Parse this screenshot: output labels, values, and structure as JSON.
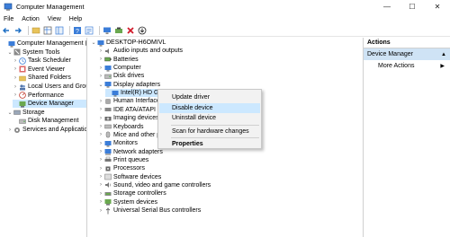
{
  "window": {
    "title": "Computer Management",
    "controls": {
      "minimize": "—",
      "maximize": "☐",
      "close": "✕"
    }
  },
  "menu": [
    "File",
    "Action",
    "View",
    "Help"
  ],
  "left_tree": [
    {
      "label": "Computer Management (Local",
      "indent": 0,
      "expander": "",
      "selected": false
    },
    {
      "label": "System Tools",
      "indent": 1,
      "expander": "⌄",
      "selected": false
    },
    {
      "label": "Task Scheduler",
      "indent": 2,
      "expander": "›",
      "selected": false
    },
    {
      "label": "Event Viewer",
      "indent": 2,
      "expander": "›",
      "selected": false
    },
    {
      "label": "Shared Folders",
      "indent": 2,
      "expander": "›",
      "selected": false
    },
    {
      "label": "Local Users and Groups",
      "indent": 2,
      "expander": "›",
      "selected": false
    },
    {
      "label": "Performance",
      "indent": 2,
      "expander": "›",
      "selected": false
    },
    {
      "label": "Device Manager",
      "indent": 2,
      "expander": "",
      "selected": true
    },
    {
      "label": "Storage",
      "indent": 1,
      "expander": "⌄",
      "selected": false
    },
    {
      "label": "Disk Management",
      "indent": 2,
      "expander": "",
      "selected": false
    },
    {
      "label": "Services and Applications",
      "indent": 1,
      "expander": "›",
      "selected": false
    }
  ],
  "device_tree": [
    {
      "label": "DESKTOP-H6OMIVL",
      "indent": 0,
      "expander": "⌄"
    },
    {
      "label": "Audio inputs and outputs",
      "indent": 1,
      "expander": "›"
    },
    {
      "label": "Batteries",
      "indent": 1,
      "expander": "›"
    },
    {
      "label": "Computer",
      "indent": 1,
      "expander": "›"
    },
    {
      "label": "Disk drives",
      "indent": 1,
      "expander": "›"
    },
    {
      "label": "Display adapters",
      "indent": 1,
      "expander": "⌄"
    },
    {
      "label": "Intel(R) HD G",
      "indent": 2,
      "expander": "",
      "selected": true
    },
    {
      "label": "Human Interface",
      "indent": 1,
      "expander": "›"
    },
    {
      "label": "IDE ATA/ATAPI c",
      "indent": 1,
      "expander": "›"
    },
    {
      "label": "Imaging devices",
      "indent": 1,
      "expander": "›"
    },
    {
      "label": "Keyboards",
      "indent": 1,
      "expander": "›"
    },
    {
      "label": "Mice and other p",
      "indent": 1,
      "expander": "›"
    },
    {
      "label": "Monitors",
      "indent": 1,
      "expander": "›"
    },
    {
      "label": "Network adapters",
      "indent": 1,
      "expander": "›"
    },
    {
      "label": "Print queues",
      "indent": 1,
      "expander": "›"
    },
    {
      "label": "Processors",
      "indent": 1,
      "expander": "›"
    },
    {
      "label": "Software devices",
      "indent": 1,
      "expander": "›"
    },
    {
      "label": "Sound, video and game controllers",
      "indent": 1,
      "expander": "›"
    },
    {
      "label": "Storage controllers",
      "indent": 1,
      "expander": "›"
    },
    {
      "label": "System devices",
      "indent": 1,
      "expander": "›"
    },
    {
      "label": "Universal Serial Bus controllers",
      "indent": 1,
      "expander": "›"
    }
  ],
  "context_menu": {
    "items": [
      "Update driver",
      "Disable device",
      "Uninstall device",
      "Scan for hardware changes",
      "Properties"
    ],
    "highlighted": "Disable device"
  },
  "actions": {
    "header": "Actions",
    "section": "Device Manager",
    "more": "More Actions"
  },
  "colors": {
    "selection": "#cce8ff",
    "actions_section_bg": "#cfe3f5",
    "accent_blue": "#1e6fc4"
  }
}
